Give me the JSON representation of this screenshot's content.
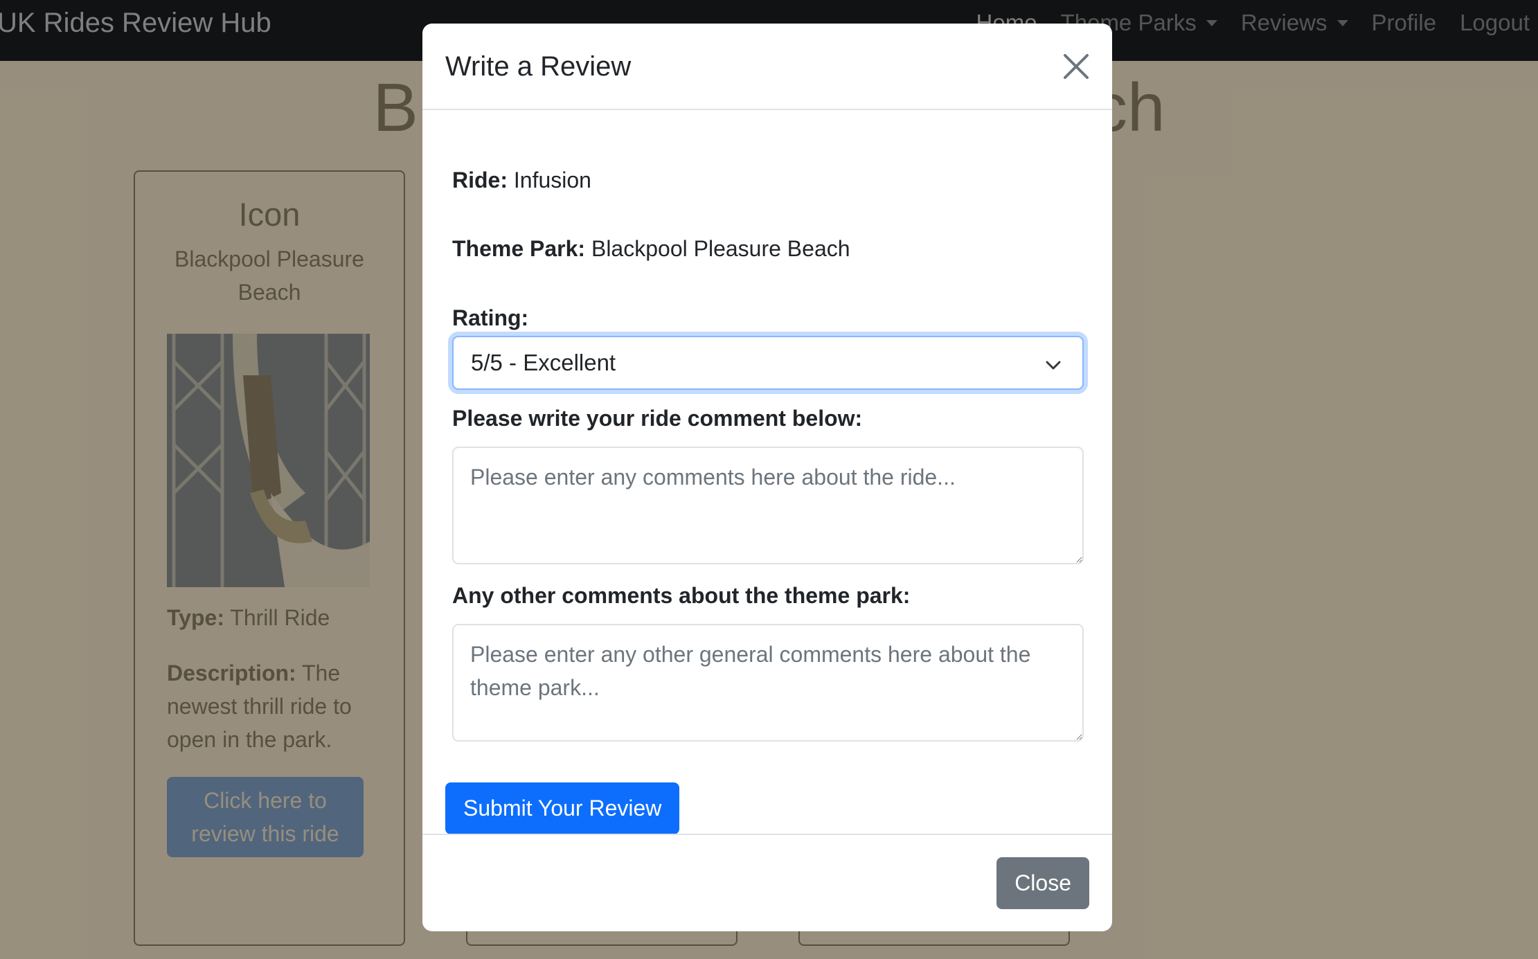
{
  "navbar": {
    "brand": "UK Rides Review Hub",
    "links": [
      {
        "label": "Home"
      },
      {
        "label": "Theme Parks"
      },
      {
        "label": "Reviews"
      },
      {
        "label": "Profile"
      },
      {
        "label": "Logout"
      }
    ]
  },
  "page": {
    "title": "Blackpool Pleasure Beach"
  },
  "ride_card": {
    "name": "Icon",
    "park": "Blackpool Pleasure Beach",
    "type_label": "Type:",
    "type_value": "Thrill Ride",
    "description_label": "Description:",
    "description_value": "The newest thrill ride to open in the park.",
    "review_button": "Click here to review this ride"
  },
  "modal": {
    "title": "Write a Review",
    "ride_label": "Ride:",
    "ride_value": "Infusion",
    "park_label": "Theme Park:",
    "park_value": "Blackpool Pleasure Beach",
    "rating_label": "Rating:",
    "rating_selected": "5/5 - Excellent",
    "ride_comment_label": "Please write your ride comment below:",
    "ride_comment_placeholder": "Please enter any comments here about the ride...",
    "park_comment_label": "Any other comments about the theme park:",
    "park_comment_placeholder": "Please enter any other general comments here about the theme park...",
    "submit_label": "Submit Your Review",
    "close_label": "Close"
  },
  "colors": {
    "navbar": "#212529",
    "primary": "#0d6efd",
    "secondary": "#6c757d",
    "focus_ring": "#86b7fe"
  },
  "icons": {
    "close": "close-icon",
    "select_caret": "chevron-down-icon",
    "nav_caret": "caret-down-icon"
  }
}
